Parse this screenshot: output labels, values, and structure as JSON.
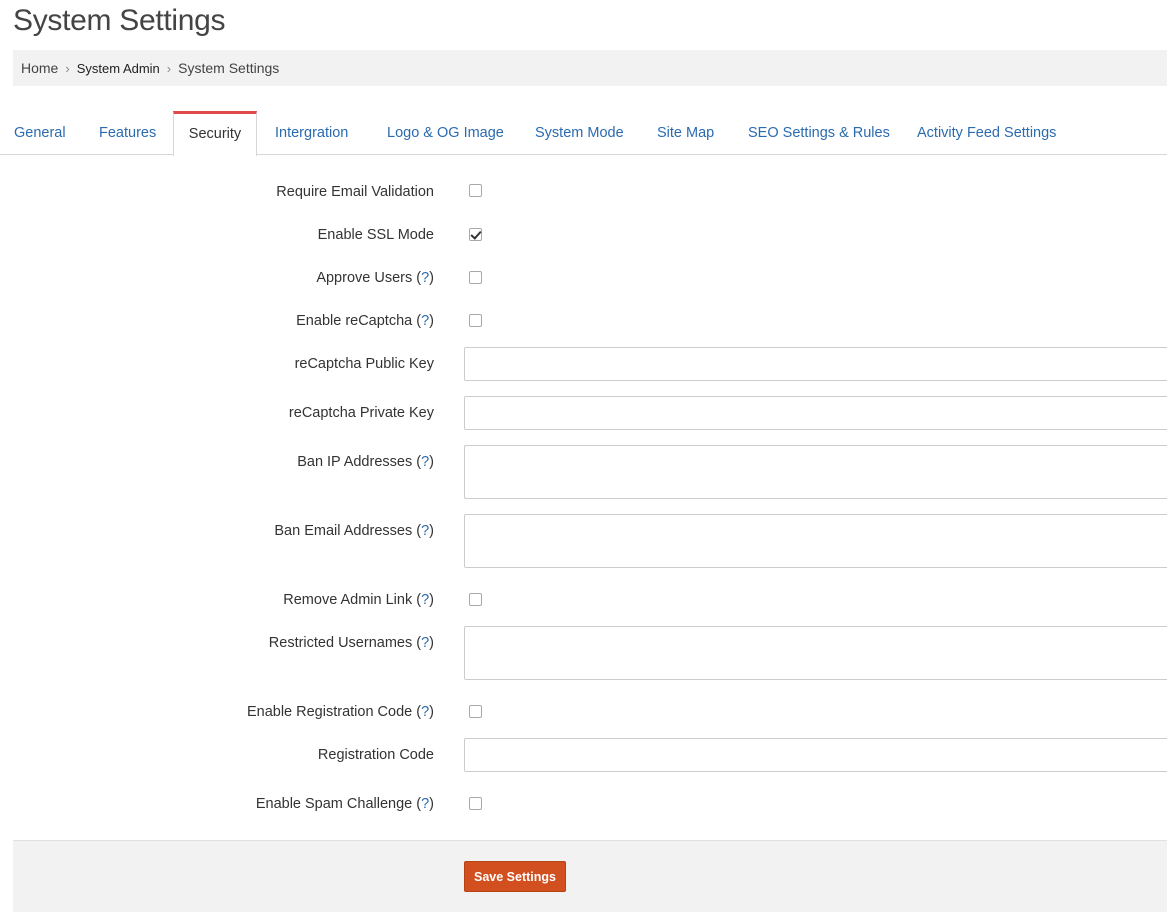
{
  "page": {
    "title": "System Settings"
  },
  "breadcrumb": {
    "items": [
      "Home",
      "System Admin",
      "System Settings"
    ],
    "separator": "›"
  },
  "tabs": [
    {
      "label": "General",
      "active": false
    },
    {
      "label": "Features",
      "active": false
    },
    {
      "label": "Security",
      "active": true
    },
    {
      "label": "Intergration",
      "active": false
    },
    {
      "label": "Logo & OG Image",
      "active": false
    },
    {
      "label": "System Mode",
      "active": false
    },
    {
      "label": "Site Map",
      "active": false
    },
    {
      "label": "SEO Settings & Rules",
      "active": false
    },
    {
      "label": "Activity Feed Settings",
      "active": false
    }
  ],
  "help_marker": "?",
  "fields": {
    "require_email_validation": {
      "label": "Require Email Validation",
      "checked": false
    },
    "enable_ssl_mode": {
      "label": "Enable SSL Mode",
      "checked": true
    },
    "approve_users": {
      "label": "Approve Users",
      "checked": false
    },
    "enable_recaptcha": {
      "label": "Enable reCaptcha",
      "checked": false
    },
    "recaptcha_public_key": {
      "label": "reCaptcha Public Key",
      "value": ""
    },
    "recaptcha_private_key": {
      "label": "reCaptcha Private Key",
      "value": ""
    },
    "ban_ip_addresses": {
      "label": "Ban IP Addresses",
      "value": ""
    },
    "ban_email_addresses": {
      "label": "Ban Email Addresses",
      "value": ""
    },
    "remove_admin_link": {
      "label": "Remove Admin Link",
      "checked": false
    },
    "restricted_usernames": {
      "label": "Restricted Usernames",
      "value": ""
    },
    "enable_registration_code": {
      "label": "Enable Registration Code",
      "checked": false
    },
    "registration_code": {
      "label": "Registration Code",
      "value": ""
    },
    "enable_spam_challenge": {
      "label": "Enable Spam Challenge",
      "checked": false
    }
  },
  "footer": {
    "save_label": "Save Settings"
  },
  "colors": {
    "accent_link": "#2a6bb0",
    "active_tab_border": "#e24a4a",
    "save_button": "#d2501f"
  }
}
